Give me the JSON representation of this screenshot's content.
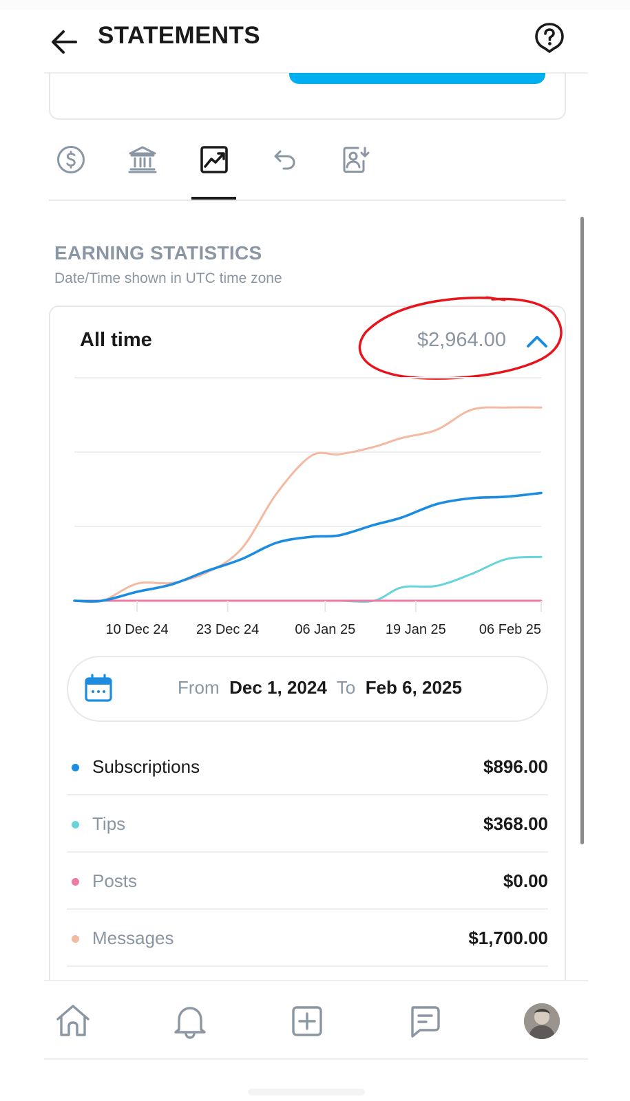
{
  "header": {
    "title": "STATEMENTS",
    "back_icon": "arrow-left-icon",
    "help_icon": "help-circle-icon"
  },
  "tabs": [
    {
      "icon": "dollar-circle-icon",
      "active": false
    },
    {
      "icon": "bank-icon",
      "active": false
    },
    {
      "icon": "chart-icon",
      "active": true
    },
    {
      "icon": "refund-arrow-icon",
      "active": false
    },
    {
      "icon": "user-download-icon",
      "active": false
    }
  ],
  "section": {
    "title": "EARNING STATISTICS",
    "subtitle": "Date/Time shown in UTC time zone"
  },
  "summary": {
    "period": "All time",
    "total": "$2,964.00"
  },
  "chart_data": {
    "type": "line",
    "x_tick_labels": [
      "10 Dec 24",
      "23 Dec 24",
      "06 Jan 25",
      "19 Jan 25",
      "06 Feb 25"
    ],
    "x": [
      "2024-12-01",
      "2024-12-05",
      "2024-12-10",
      "2024-12-15",
      "2024-12-20",
      "2024-12-25",
      "2024-12-30",
      "2025-01-04",
      "2025-01-08",
      "2025-01-13",
      "2025-01-17",
      "2025-01-22",
      "2025-01-27",
      "2025-02-01",
      "2025-02-06"
    ],
    "series": [
      {
        "name": "Subscriptions",
        "color": "#1b8ce0",
        "values": [
          0,
          0,
          60,
          110,
          200,
          280,
          390,
          430,
          440,
          510,
          560,
          650,
          690,
          700,
          725
        ]
      },
      {
        "name": "Tips",
        "color": "#68d4da",
        "values": [
          0,
          0,
          0,
          0,
          0,
          0,
          0,
          0,
          0,
          0,
          90,
          100,
          180,
          280,
          295
        ]
      },
      {
        "name": "Posts",
        "color": "#ef7aa3",
        "values": [
          0,
          0,
          0,
          0,
          0,
          0,
          0,
          0,
          0,
          0,
          0,
          0,
          0,
          0,
          0
        ]
      },
      {
        "name": "Messages",
        "color": "#f4b9a1",
        "values": [
          0,
          0,
          115,
          120,
          190,
          350,
          720,
          975,
          985,
          1035,
          1095,
          1150,
          1285,
          1300,
          1300
        ]
      }
    ],
    "ylim": [
      0,
      1500
    ],
    "grid": true
  },
  "date_range": {
    "from_label": "From",
    "from_value": "Dec 1, 2024",
    "to_label": "To",
    "to_value": "Feb 6, 2025"
  },
  "breakdown": [
    {
      "label": "Subscriptions",
      "value": "$896.00",
      "color": "#1b8ce0",
      "label_color": "#1a1a1a"
    },
    {
      "label": "Tips",
      "value": "$368.00",
      "color": "#68d4da",
      "label_color": "#8a96a3"
    },
    {
      "label": "Posts",
      "value": "$0.00",
      "color": "#ef7aa3",
      "label_color": "#8a96a3"
    },
    {
      "label": "Messages",
      "value": "$1,700.00",
      "color": "#f4b9a1",
      "label_color": "#8a96a3"
    }
  ],
  "bottom_nav": [
    {
      "icon": "home-icon"
    },
    {
      "icon": "bell-icon"
    },
    {
      "icon": "plus-square-icon"
    },
    {
      "icon": "message-icon"
    },
    {
      "icon": "avatar"
    }
  ],
  "colors": {
    "accent": "#00aff0",
    "muted": "#8a96a3",
    "annotation": "#e8141c"
  }
}
